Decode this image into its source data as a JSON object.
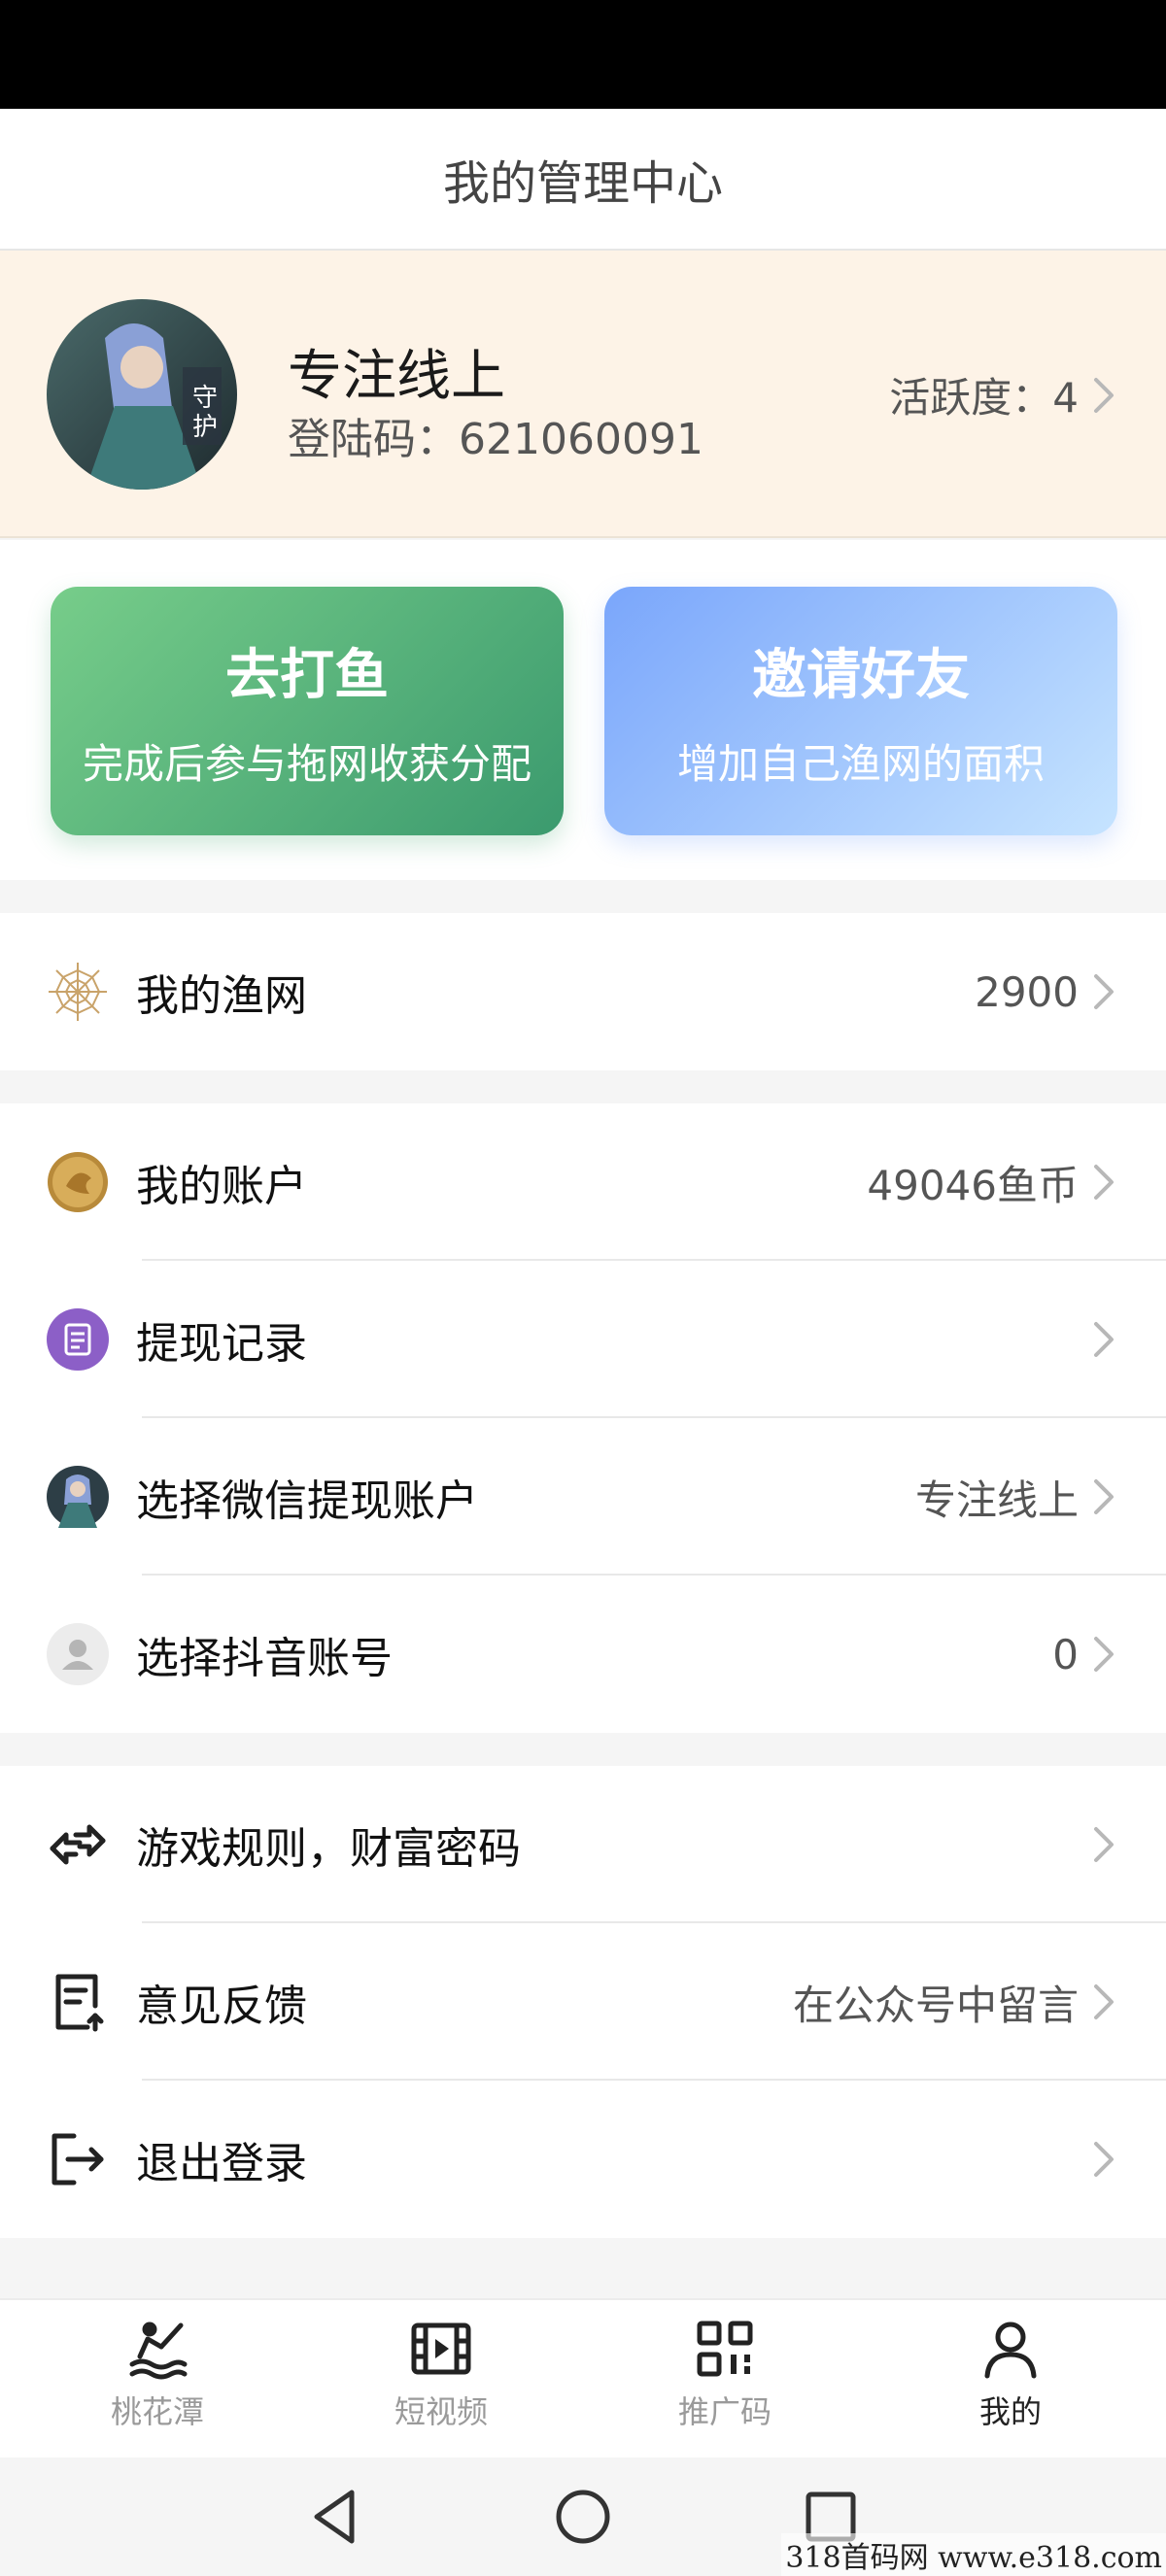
{
  "header": {
    "title": "我的管理中心"
  },
  "profile": {
    "nickname": "专注线上",
    "login_code": "登陆码：621060091",
    "activity": "活跃度：4"
  },
  "actions": [
    {
      "title": "去打鱼",
      "subtitle": "完成后参与拖网收获分配"
    },
    {
      "title": "邀请好友",
      "subtitle": "增加自己渔网的面积"
    }
  ],
  "menu": {
    "net": {
      "label": "我的渔网",
      "value": "2900",
      "icon": "spider-web-icon"
    },
    "account": {
      "label": "我的账户",
      "value": "49046鱼币",
      "icon": "coin-icon"
    },
    "withdraw_record": {
      "label": "提现记录",
      "value": "",
      "icon": "document-icon"
    },
    "wechat_account": {
      "label": "选择微信提现账户",
      "value": "专注线上",
      "icon": "wechat-avatar-icon"
    },
    "douyin_account": {
      "label": "选择抖音账号",
      "value": "0",
      "icon": "user-icon"
    },
    "rules": {
      "label": "游戏规则，财富密码",
      "value": "",
      "icon": "swap-arrows-icon"
    },
    "feedback": {
      "label": "意见反馈",
      "value": "在公众号中留言",
      "icon": "feedback-icon"
    },
    "logout": {
      "label": "退出登录",
      "value": "",
      "icon": "logout-icon"
    }
  },
  "tabs": [
    {
      "label": "桃花潭",
      "icon": "fishing-icon",
      "active": false
    },
    {
      "label": "短视频",
      "icon": "video-icon",
      "active": false
    },
    {
      "label": "推广码",
      "icon": "qrcode-icon",
      "active": false
    },
    {
      "label": "我的",
      "icon": "person-icon",
      "active": true
    }
  ],
  "watermark": "318首码网 www.e318.com",
  "colors": {
    "profile_bg": "#fdf3e7",
    "fish_button": "#4caf78",
    "invite_button": "#8ab4fb",
    "page_bg": "#f5f5f5"
  }
}
